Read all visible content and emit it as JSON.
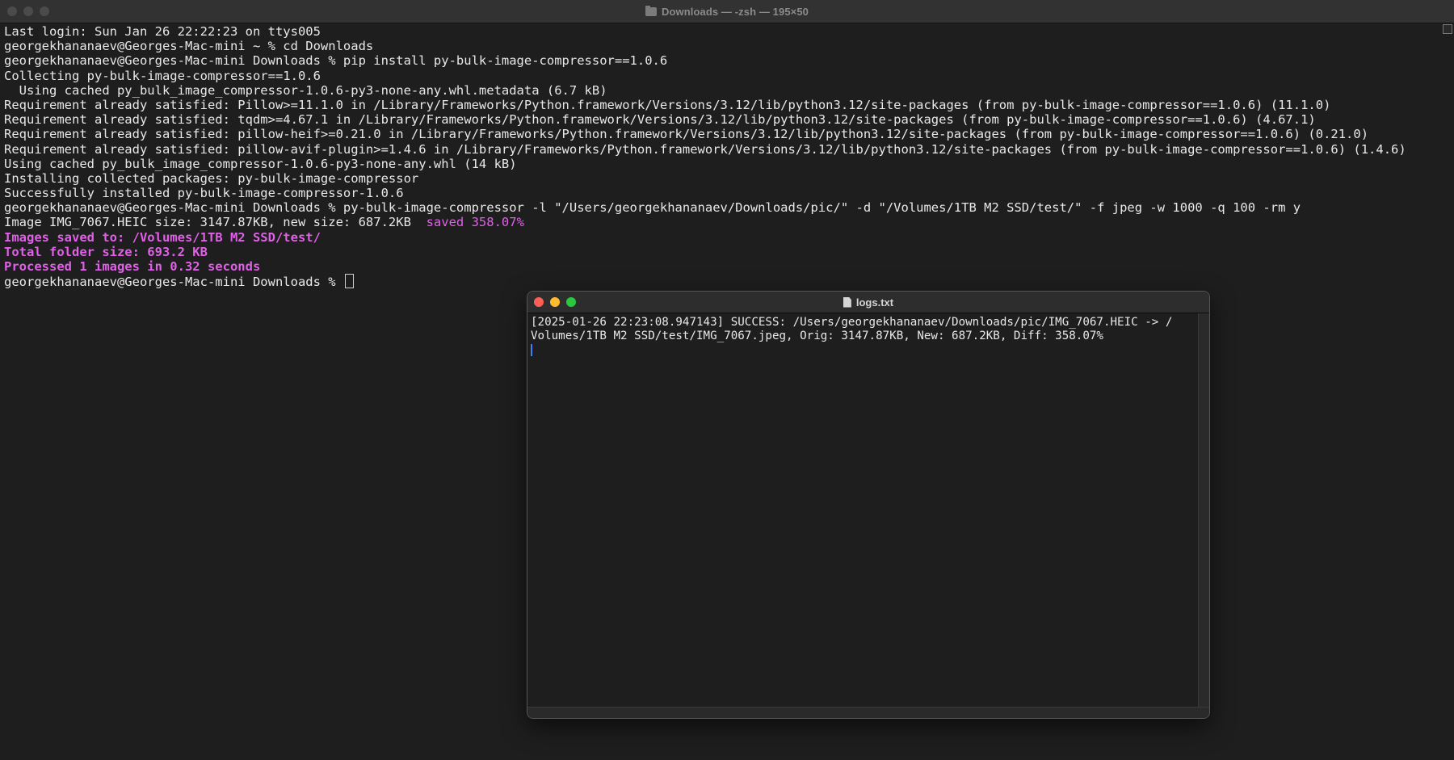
{
  "terminal": {
    "title": "Downloads — -zsh — 195×50",
    "lines": [
      "Last login: Sun Jan 26 22:22:23 on ttys005",
      "georgekhananaev@Georges-Mac-mini ~ % cd Downloads",
      "georgekhananaev@Georges-Mac-mini Downloads % pip install py-bulk-image-compressor==1.0.6",
      "Collecting py-bulk-image-compressor==1.0.6",
      "  Using cached py_bulk_image_compressor-1.0.6-py3-none-any.whl.metadata (6.7 kB)",
      "Requirement already satisfied: Pillow>=11.1.0 in /Library/Frameworks/Python.framework/Versions/3.12/lib/python3.12/site-packages (from py-bulk-image-compressor==1.0.6) (11.1.0)",
      "Requirement already satisfied: tqdm>=4.67.1 in /Library/Frameworks/Python.framework/Versions/3.12/lib/python3.12/site-packages (from py-bulk-image-compressor==1.0.6) (4.67.1)",
      "Requirement already satisfied: pillow-heif>=0.21.0 in /Library/Frameworks/Python.framework/Versions/3.12/lib/python3.12/site-packages (from py-bulk-image-compressor==1.0.6) (0.21.0)",
      "Requirement already satisfied: pillow-avif-plugin>=1.4.6 in /Library/Frameworks/Python.framework/Versions/3.12/lib/python3.12/site-packages (from py-bulk-image-compressor==1.0.6) (1.4.6)",
      "Using cached py_bulk_image_compressor-1.0.6-py3-none-any.whl (14 kB)",
      "Installing collected packages: py-bulk-image-compressor",
      "Successfully installed py-bulk-image-compressor-1.0.6",
      "georgekhananaev@Georges-Mac-mini Downloads % py-bulk-image-compressor -l \"/Users/georgekhananaev/Downloads/pic/\" -d \"/Volumes/1TB M2 SSD/test/\" -f jpeg -w 1000 -q 100 -rm y"
    ],
    "image_line": "Image IMG_7067.HEIC size: 3147.87KB, new size: 687.2KB  ",
    "image_line_saved": "saved 358.07%",
    "summary_lines": [
      "Images saved to: /Volumes/1TB M2 SSD/test/",
      "Total folder size: 693.2 KB",
      "Processed 1 images in 0.32 seconds"
    ],
    "prompt": "georgekhananaev@Georges-Mac-mini Downloads % "
  },
  "log_window": {
    "title": "logs.txt",
    "lines": [
      "[2025-01-26 22:23:08.947143] SUCCESS: /Users/georgekhananaev/Downloads/pic/IMG_7067.HEIC -> /",
      "Volumes/1TB M2 SSD/test/IMG_7067.jpeg, Orig: 3147.87KB, New: 687.2KB, Diff: 358.07%"
    ]
  },
  "colors": {
    "terminal_bg": "#1e1e1e",
    "text": "#e8e8e8",
    "highlight": "#e060e8",
    "close": "#ff5f57",
    "minimize": "#febc2e",
    "zoom": "#28c840"
  }
}
